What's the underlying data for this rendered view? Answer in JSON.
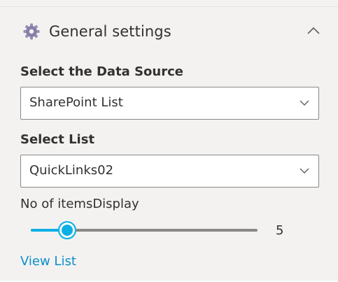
{
  "section": {
    "title": "General settings",
    "icon": "gear-icon",
    "expanded": true
  },
  "fields": {
    "data_source": {
      "label": "Select the Data Source",
      "value": "SharePoint List"
    },
    "list": {
      "label": "Select List",
      "value": "QuickLinks02"
    },
    "items_display": {
      "label": "No of itemsDisplay",
      "value": "5",
      "fraction": 0.16
    }
  },
  "link": {
    "label": "View List"
  },
  "colors": {
    "accent": "#0bb0e5",
    "link": "#0a8fc9",
    "background": "#f3f2f1"
  }
}
